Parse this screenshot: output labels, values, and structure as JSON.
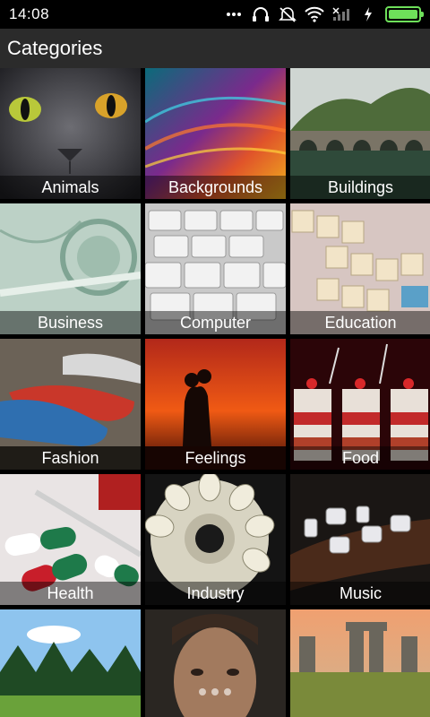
{
  "status_bar": {
    "time": "14:08",
    "battery_level": 1.0,
    "accent": "#6ee05a"
  },
  "app_bar": {
    "title": "Categories"
  },
  "categories": [
    {
      "label": "Animals"
    },
    {
      "label": "Backgrounds"
    },
    {
      "label": "Buildings"
    },
    {
      "label": "Business"
    },
    {
      "label": "Computer"
    },
    {
      "label": "Education"
    },
    {
      "label": "Fashion"
    },
    {
      "label": "Feelings"
    },
    {
      "label": "Food"
    },
    {
      "label": "Health"
    },
    {
      "label": "Industry"
    },
    {
      "label": "Music"
    },
    {
      "label": ""
    },
    {
      "label": ""
    },
    {
      "label": ""
    }
  ]
}
